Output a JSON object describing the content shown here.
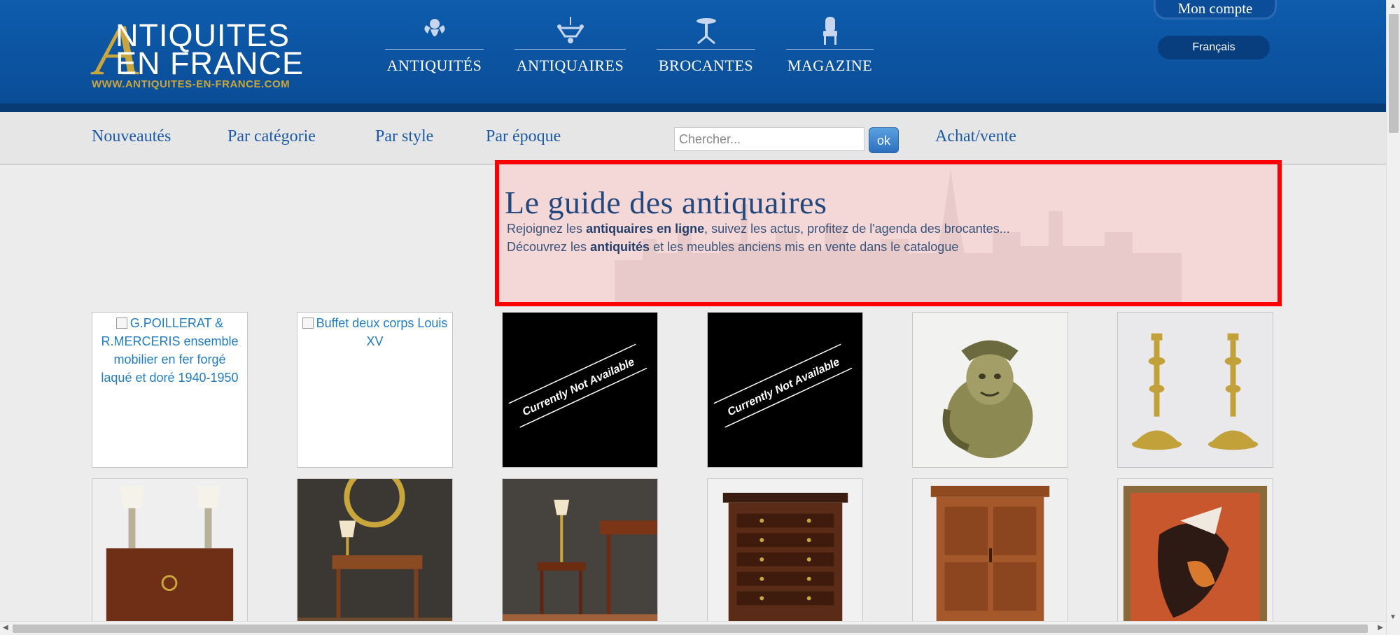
{
  "header": {
    "logo": {
      "line1": "NTIQUITES",
      "line2": "EN FRANCE",
      "url": "WWW.ANTIQUITES-EN-FRANCE.COM"
    },
    "main_nav": [
      {
        "label": "ANTIQUITÉS",
        "icon": "cherub-icon"
      },
      {
        "label": "ANTIQUAIRES",
        "icon": "chandelier-icon"
      },
      {
        "label": "BROCANTES",
        "icon": "gueridon-table-icon"
      },
      {
        "label": "MAGAZINE",
        "icon": "armchair-icon"
      }
    ],
    "account_label": "Mon compte",
    "language": "Français"
  },
  "subnav": {
    "links": [
      "Nouveautés",
      "Par catégorie",
      "Par style",
      "Par époque"
    ],
    "search_placeholder": "Chercher...",
    "search_button": "ok",
    "sell_link": "Achat/vente"
  },
  "guide": {
    "title": "Le guide des antiquaires",
    "line1_a": "Rejoignez les ",
    "line1_b": "antiquaires en ligne",
    "line1_c": ", suivez les actus, profitez de l'agenda des brocantes...",
    "line2_a": "Découvrez les ",
    "line2_b": "antiquités",
    "line2_c": " et les meubles anciens mis en vente dans le catalogue"
  },
  "products": [
    {
      "type": "broken",
      "alt": "G.POILLERAT & R.MERCERIS ensemble mobilier en fer forgé laqué et doré 1940-1950"
    },
    {
      "type": "broken",
      "alt": "Buffet deux corps Louis XV"
    },
    {
      "type": "unavailable",
      "text": "Currently Not Available"
    },
    {
      "type": "unavailable",
      "text": "Currently Not Available"
    },
    {
      "type": "photo",
      "subject": "stoneware jug"
    },
    {
      "type": "photo",
      "subject": "brass candlesticks"
    },
    {
      "type": "photo",
      "subject": "sideboard with lamps"
    },
    {
      "type": "photo",
      "subject": "writing desk"
    },
    {
      "type": "photo",
      "subject": "desk and side table"
    },
    {
      "type": "photo",
      "subject": "chest of drawers"
    },
    {
      "type": "photo",
      "subject": "wooden cabinet"
    },
    {
      "type": "photo",
      "subject": "framed painting"
    }
  ],
  "colors": {
    "header_blue": "#0b4d98",
    "gold": "#c9a63c",
    "link_blue": "#1a5aa6",
    "highlight_red": "#ff0000"
  }
}
